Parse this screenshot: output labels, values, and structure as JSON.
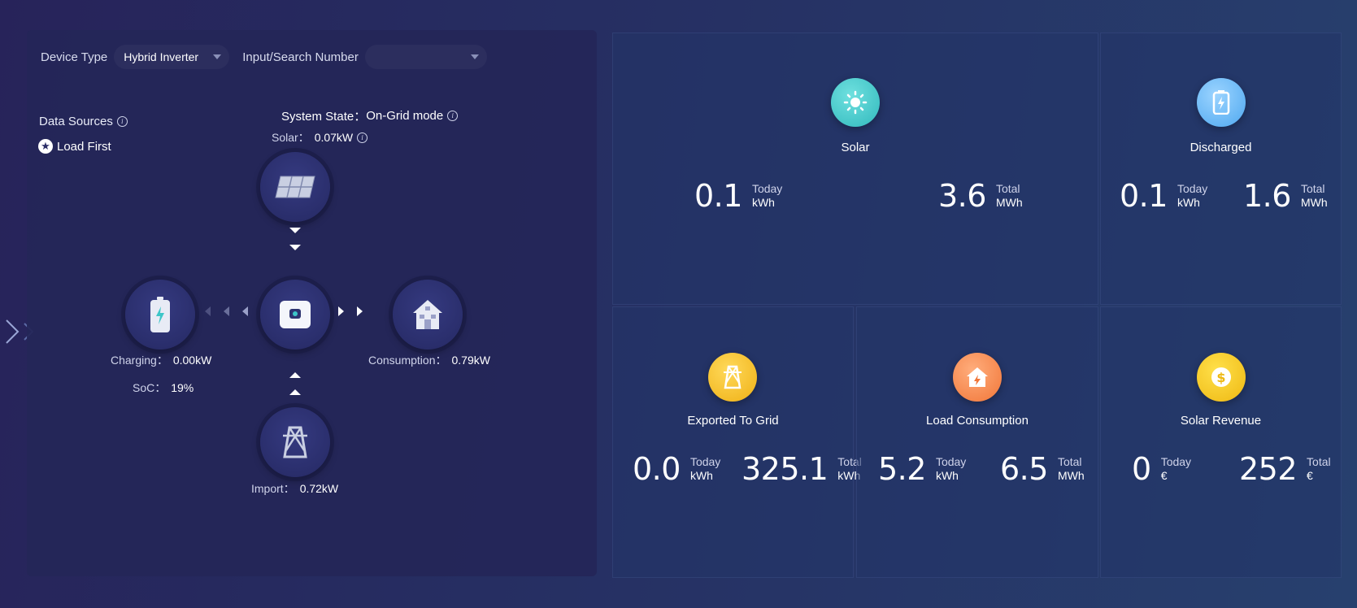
{
  "toolbar": {
    "device_type_label": "Device Type",
    "device_type_value": "Hybrid Inverter",
    "search_label": "Input/Search Number",
    "search_value": ""
  },
  "data_sources": {
    "label": "Data Sources",
    "mode": "Load First"
  },
  "system": {
    "state_label": "System State：",
    "state_value": "On-Grid mode",
    "solar_label": "Solar：",
    "solar_value": "0.07kW"
  },
  "flow": {
    "charging_label": "Charging：",
    "charging_value": "0.00kW",
    "soc_label": "SoC：",
    "soc_value": "19%",
    "consumption_label": "Consumption：",
    "consumption_value": "0.79kW",
    "import_label": "Import：",
    "import_value": "0.72kW"
  },
  "cards": {
    "solar": {
      "title": "Solar",
      "today_value": "0.1",
      "today_label": "Today",
      "today_unit": "kWh",
      "total_value": "3.6",
      "total_label": "Total",
      "total_unit": "MWh",
      "color": "#3dc6c8"
    },
    "discharged": {
      "title": "Discharged",
      "today_value": "0.1",
      "today_label": "Today",
      "today_unit": "kWh",
      "total_value": "1.6",
      "total_label": "Total",
      "total_unit": "MWh",
      "color": "#62b4f4"
    },
    "exported": {
      "title": "Exported To Grid",
      "today_value": "0.0",
      "today_label": "Today",
      "today_unit": "kWh",
      "total_value": "325.1",
      "total_label": "Total",
      "total_unit": "kWh",
      "color": "#f2bd22"
    },
    "load": {
      "title": "Load Consumption",
      "today_value": "5.2",
      "today_label": "Today",
      "today_unit": "kWh",
      "total_value": "6.5",
      "total_label": "Total",
      "total_unit": "MWh",
      "color": "#f58a4e"
    },
    "revenue": {
      "title": "Solar Revenue",
      "today_value": "0",
      "today_label": "Today",
      "today_unit": "€",
      "total_value": "252",
      "total_label": "Total",
      "total_unit": "€",
      "color": "#f2c21e"
    }
  }
}
